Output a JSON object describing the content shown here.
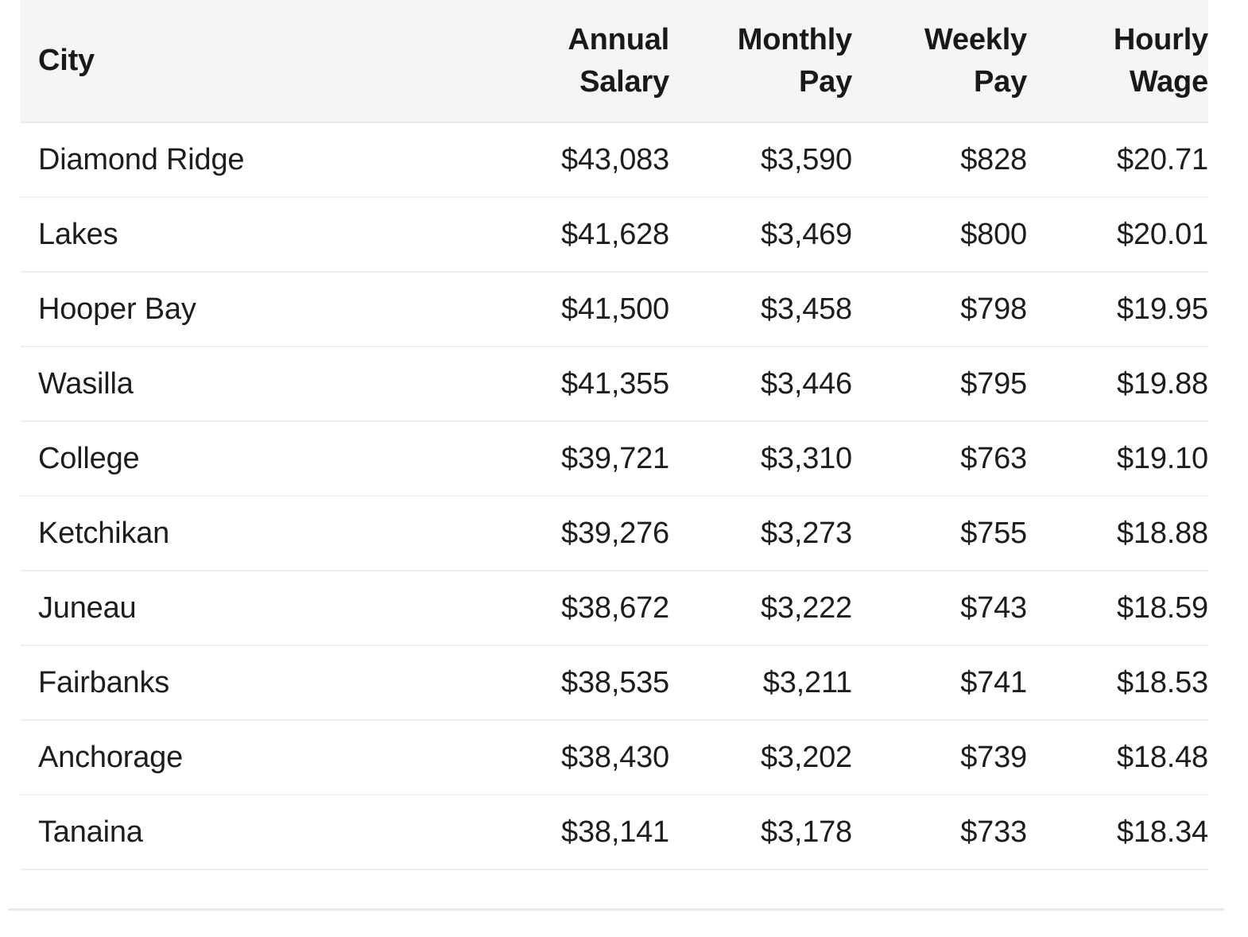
{
  "table": {
    "columns": [
      {
        "key": "city",
        "label": "City",
        "align": "left"
      },
      {
        "key": "annual",
        "label": "Annual\nSalary",
        "align": "right"
      },
      {
        "key": "monthly",
        "label": "Monthly\nPay",
        "align": "right"
      },
      {
        "key": "weekly",
        "label": "Weekly\nPay",
        "align": "right"
      },
      {
        "key": "hourly",
        "label": "Hourly\nWage",
        "align": "right"
      }
    ],
    "rows": [
      {
        "city": "Diamond Ridge",
        "annual": "$43,083",
        "monthly": "$3,590",
        "weekly": "$828",
        "hourly": "$20.71"
      },
      {
        "city": "Lakes",
        "annual": "$41,628",
        "monthly": "$3,469",
        "weekly": "$800",
        "hourly": "$20.01"
      },
      {
        "city": "Hooper Bay",
        "annual": "$41,500",
        "monthly": "$3,458",
        "weekly": "$798",
        "hourly": "$19.95"
      },
      {
        "city": "Wasilla",
        "annual": "$41,355",
        "monthly": "$3,446",
        "weekly": "$795",
        "hourly": "$19.88"
      },
      {
        "city": "College",
        "annual": "$39,721",
        "monthly": "$3,310",
        "weekly": "$763",
        "hourly": "$19.10"
      },
      {
        "city": "Ketchikan",
        "annual": "$39,276",
        "monthly": "$3,273",
        "weekly": "$755",
        "hourly": "$18.88"
      },
      {
        "city": "Juneau",
        "annual": "$38,672",
        "monthly": "$3,222",
        "weekly": "$743",
        "hourly": "$18.59"
      },
      {
        "city": "Fairbanks",
        "annual": "$38,535",
        "monthly": "$3,211",
        "weekly": "$741",
        "hourly": "$18.53"
      },
      {
        "city": "Anchorage",
        "annual": "$38,430",
        "monthly": "$3,202",
        "weekly": "$739",
        "hourly": "$18.48"
      },
      {
        "city": "Tanaina",
        "annual": "$38,141",
        "monthly": "$3,178",
        "weekly": "$733",
        "hourly": "$18.34"
      }
    ]
  },
  "chart_data": {
    "type": "table",
    "title": "",
    "columns": [
      "City",
      "Annual Salary",
      "Monthly Pay",
      "Weekly Pay",
      "Hourly Wage"
    ],
    "categories": [
      "Diamond Ridge",
      "Lakes",
      "Hooper Bay",
      "Wasilla",
      "College",
      "Ketchikan",
      "Juneau",
      "Fairbanks",
      "Anchorage",
      "Tanaina"
    ],
    "series": [
      {
        "name": "Annual Salary",
        "values": [
          43083,
          41628,
          41500,
          41355,
          39721,
          39276,
          38672,
          38535,
          38430,
          38141
        ]
      },
      {
        "name": "Monthly Pay",
        "values": [
          3590,
          3469,
          3458,
          3446,
          3310,
          3273,
          3222,
          3211,
          3202,
          3178
        ]
      },
      {
        "name": "Weekly Pay",
        "values": [
          828,
          800,
          798,
          795,
          763,
          755,
          743,
          741,
          739,
          733
        ]
      },
      {
        "name": "Hourly Wage",
        "values": [
          20.71,
          20.01,
          19.95,
          19.88,
          19.1,
          18.88,
          18.59,
          18.53,
          18.48,
          18.34
        ]
      }
    ]
  },
  "theme": {
    "header_background": "#f5f5f6",
    "row_background": "#ffffff",
    "text_color": "#1c1d1f",
    "header_text_color": "#18191b",
    "divider_color": "#f0f0f1",
    "header_divider_color": "#e9eaeb"
  }
}
